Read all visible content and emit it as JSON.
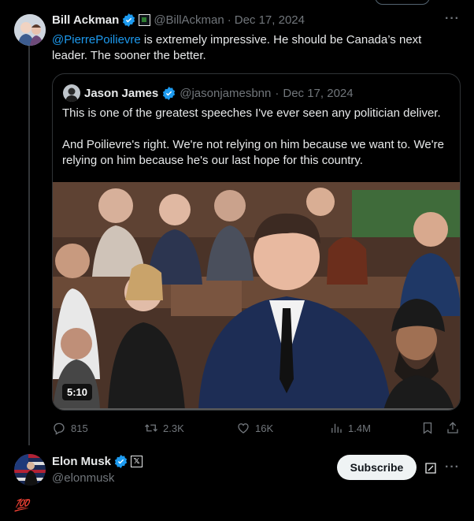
{
  "colors": {
    "accent": "#1d9bf0",
    "muted": "#71767b",
    "text": "#e7e9ea",
    "background": "#000000"
  },
  "tweet": {
    "author_name": "Bill Ackman",
    "handle": "@BillAckman",
    "separator": "·",
    "date": "Dec 17, 2024",
    "mention": "@PierrePoilievre",
    "text": " is extremely impressive. He should be Canada’s next leader. The sooner the better.",
    "more_icon": "more-icon"
  },
  "quote": {
    "author_name": "Jason James",
    "handle": "@jasonjamesbnn",
    "separator": "·",
    "date": "Dec 17, 2024",
    "paragraph1": "This is one of the greatest speeches I've ever seen any politician deliver.",
    "paragraph2": "And Poilievre's right. We're not relying on him because we want to. We're relying on him because he's our last hope for this country.",
    "video_duration": "5:10"
  },
  "actions": {
    "replies": "815",
    "reposts": "2.3K",
    "likes": "16K",
    "views": "1.4M"
  },
  "reply": {
    "author_name": "Elon Musk",
    "handle": "@elonmusk",
    "subscribe_label": "Subscribe",
    "text": "💯"
  }
}
